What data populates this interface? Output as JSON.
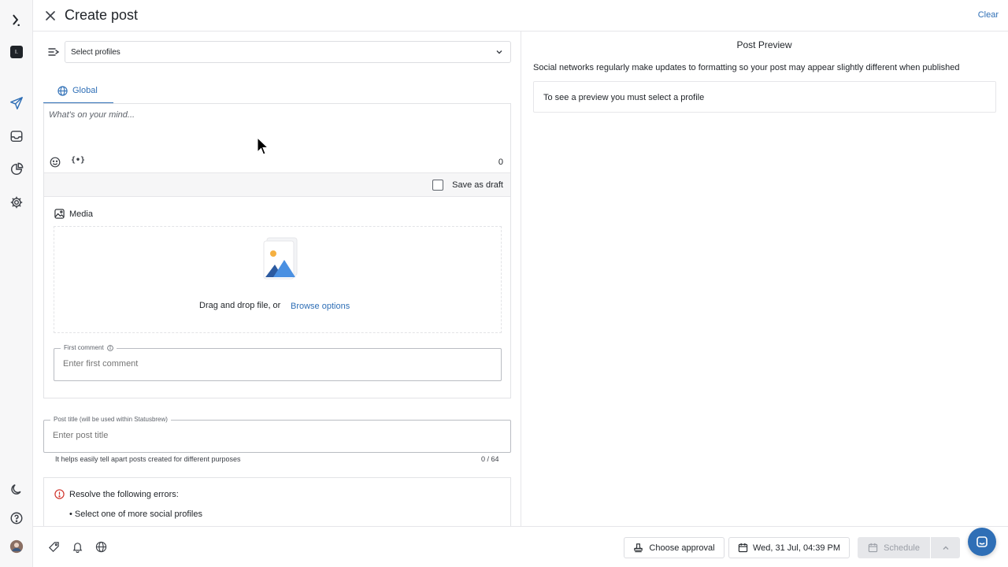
{
  "header": {
    "title": "Create post",
    "clear_label": "Clear"
  },
  "rail": {
    "workspace_initial": "I."
  },
  "composer": {
    "profiles_placeholder": "Select profiles",
    "tab_label": "Global",
    "text_placeholder": "What's on your mind...",
    "char_count": "0",
    "draft_label": "Save as draft"
  },
  "media": {
    "title": "Media",
    "drop_text": "Drag and drop file, or",
    "browse_label": "Browse options"
  },
  "first_comment": {
    "label": "First comment",
    "placeholder": "Enter first comment"
  },
  "post_title": {
    "label": "Post title (will be used within Statusbrew)",
    "placeholder": "Enter post title",
    "help": "It helps easily tell apart posts created for different purposes",
    "count": "0 / 64"
  },
  "errors": {
    "title": "Resolve the following errors:",
    "items": [
      "Select one of more social profiles"
    ]
  },
  "preview": {
    "title": "Post Preview",
    "note": "Social networks regularly make updates to formatting so your post may appear slightly different when published",
    "empty_message": "To see a preview you must select a profile"
  },
  "footer": {
    "approval_label": "Choose approval",
    "date_label": "Wed, 31 Jul, 04:39 PM",
    "schedule_label": "Schedule"
  },
  "colors": {
    "accent": "#2f6fb6",
    "error": "#d0342c",
    "disabled_bg": "#e6e7ea"
  }
}
